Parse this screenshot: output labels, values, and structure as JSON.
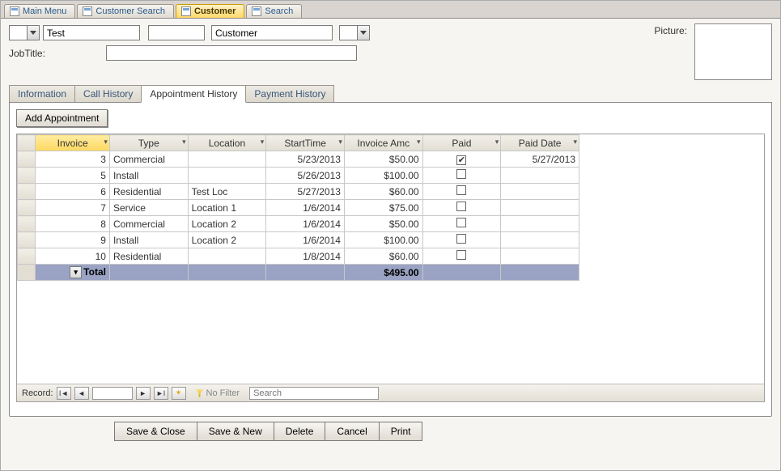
{
  "doc_tabs": [
    {
      "label": "Main Menu",
      "active": false
    },
    {
      "label": "Customer Search",
      "active": false
    },
    {
      "label": "Customer",
      "active": true
    },
    {
      "label": "Search",
      "active": false
    }
  ],
  "header": {
    "first_name": "Test",
    "middle": "",
    "last_name": "Customer",
    "jobtitle_label": "JobTitle:",
    "jobtitle_value": "",
    "picture_label": "Picture:"
  },
  "subtabs": [
    {
      "label": "Information",
      "active": false
    },
    {
      "label": "Call History",
      "active": false
    },
    {
      "label": "Appointment History",
      "active": true
    },
    {
      "label": "Payment History",
      "active": false
    }
  ],
  "add_button": "Add Appointment",
  "grid": {
    "columns": [
      "Invoice",
      "Type",
      "Location",
      "StartTime",
      "Invoice Amount",
      "Paid",
      "Paid Date"
    ],
    "sorted_col": 0,
    "rows": [
      {
        "invoice": "3",
        "type": "Commercial",
        "location": "",
        "start": "5/23/2013",
        "amount": "$50.00",
        "paid": true,
        "paid_date": "5/27/2013"
      },
      {
        "invoice": "5",
        "type": "Install",
        "location": "",
        "start": "5/26/2013",
        "amount": "$100.00",
        "paid": false,
        "paid_date": ""
      },
      {
        "invoice": "6",
        "type": "Residential",
        "location": "Test Loc",
        "start": "5/27/2013",
        "amount": "$60.00",
        "paid": false,
        "paid_date": ""
      },
      {
        "invoice": "7",
        "type": "Service",
        "location": "Location 1",
        "start": "1/6/2014",
        "amount": "$75.00",
        "paid": false,
        "paid_date": ""
      },
      {
        "invoice": "8",
        "type": "Commercial",
        "location": "Location 2",
        "start": "1/6/2014",
        "amount": "$50.00",
        "paid": false,
        "paid_date": ""
      },
      {
        "invoice": "9",
        "type": "Install",
        "location": "Location 2",
        "start": "1/6/2014",
        "amount": "$100.00",
        "paid": false,
        "paid_date": ""
      },
      {
        "invoice": "10",
        "type": "Residential",
        "location": "",
        "start": "1/8/2014",
        "amount": "$60.00",
        "paid": false,
        "paid_date": ""
      }
    ],
    "total_label": "Total",
    "total_amount": "$495.00"
  },
  "recnav": {
    "label": "Record:",
    "nofilter": "No Filter",
    "search_placeholder": "Search"
  },
  "bottom_buttons": [
    "Save & Close",
    "Save & New",
    "Delete",
    "Cancel",
    "Print"
  ]
}
